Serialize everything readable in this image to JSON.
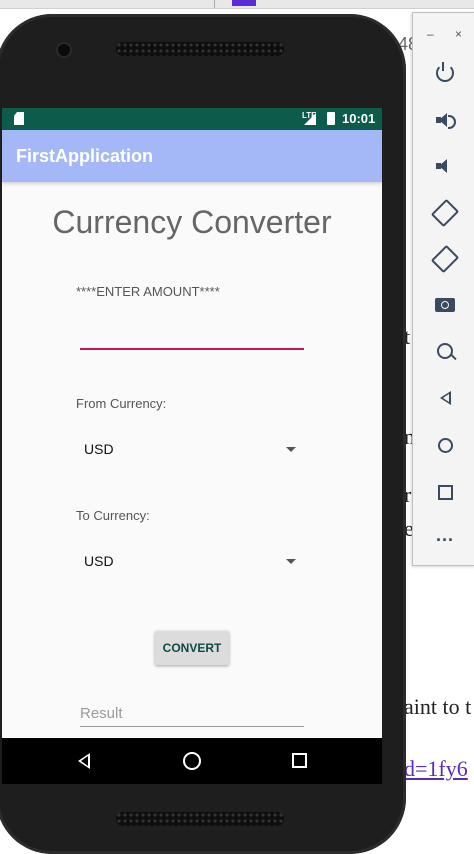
{
  "background": {
    "partial_number": "48",
    "snippets": [
      "t",
      "n",
      "r",
      "e"
    ],
    "bottom_text": "aint to t",
    "link_text": "d=1fy6"
  },
  "status_bar": {
    "time": "10:01",
    "network": "LTE"
  },
  "app": {
    "title": "FirstApplication",
    "heading": "Currency Converter",
    "amount_label": "****ENTER AMOUNT****",
    "amount_value": "",
    "from_label": "From Currency:",
    "from_value": "USD",
    "to_label": "To Currency:",
    "to_value": "USD",
    "convert_label": "CONVERT",
    "result_placeholder": "Result"
  },
  "emulator": {
    "window_controls": [
      "–",
      "×"
    ],
    "tools": [
      "power-icon",
      "volume-up-icon",
      "volume-down-icon",
      "rotate-left-icon",
      "rotate-right-icon",
      "camera-icon",
      "zoom-icon",
      "back-icon",
      "home-icon",
      "overview-icon",
      "more-icon"
    ],
    "more_label": "..."
  },
  "colors": {
    "status_bar": "#0d5b4b",
    "app_bar": "#a4b8f8",
    "accent": "#c2185b"
  }
}
